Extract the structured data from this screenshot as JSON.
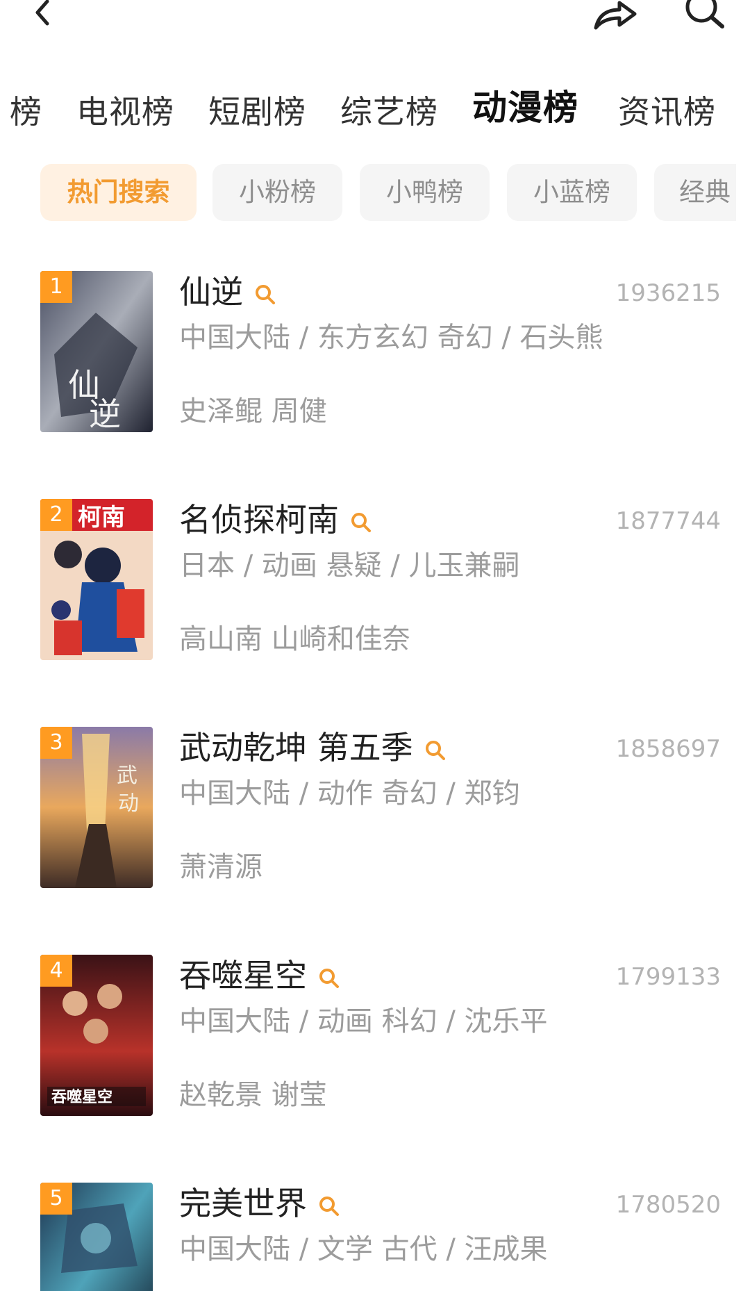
{
  "tabs": [
    {
      "label": "榜"
    },
    {
      "label": "电视榜"
    },
    {
      "label": "短剧榜"
    },
    {
      "label": "综艺榜"
    },
    {
      "label": "动漫榜"
    },
    {
      "label": "资讯榜"
    }
  ],
  "active_tab": "动漫榜",
  "chips": [
    {
      "label": "热门搜索"
    },
    {
      "label": "小粉榜"
    },
    {
      "label": "小鸭榜"
    },
    {
      "label": "小蓝榜"
    },
    {
      "label": "经典"
    }
  ],
  "active_chip": "热门搜索",
  "list": [
    {
      "rank": "1",
      "title": "仙逆",
      "count": "1936215",
      "meta": "中国大陆 / 东方玄幻 奇幻 / 石头熊",
      "cast": "史泽鲲 周健"
    },
    {
      "rank": "2",
      "title": "名侦探柯南",
      "count": "1877744",
      "meta": "日本 / 动画 悬疑 / 儿玉兼嗣",
      "cast": "高山南 山崎和佳奈"
    },
    {
      "rank": "3",
      "title": "武动乾坤 第五季",
      "count": "1858697",
      "meta": "中国大陆 / 动作 奇幻 / 郑钧",
      "cast": "萧清源"
    },
    {
      "rank": "4",
      "title": "吞噬星空",
      "count": "1799133",
      "meta": "中国大陆 / 动画 科幻 / 沈乐平",
      "cast": "赵乾景 谢莹"
    },
    {
      "rank": "5",
      "title": "完美世界",
      "count": "1780520",
      "meta": "中国大陆 / 文学 古代 / 汪成果",
      "cast": ""
    }
  ],
  "colors": {
    "accent": "#f29b31",
    "rank_badge": "#ff9b21",
    "chip_active_bg": "#fff1e2"
  },
  "icons": {
    "back": "chevron-left-icon",
    "share": "share-arrow-icon",
    "search": "search-icon",
    "inline_search": "search-small-icon"
  }
}
